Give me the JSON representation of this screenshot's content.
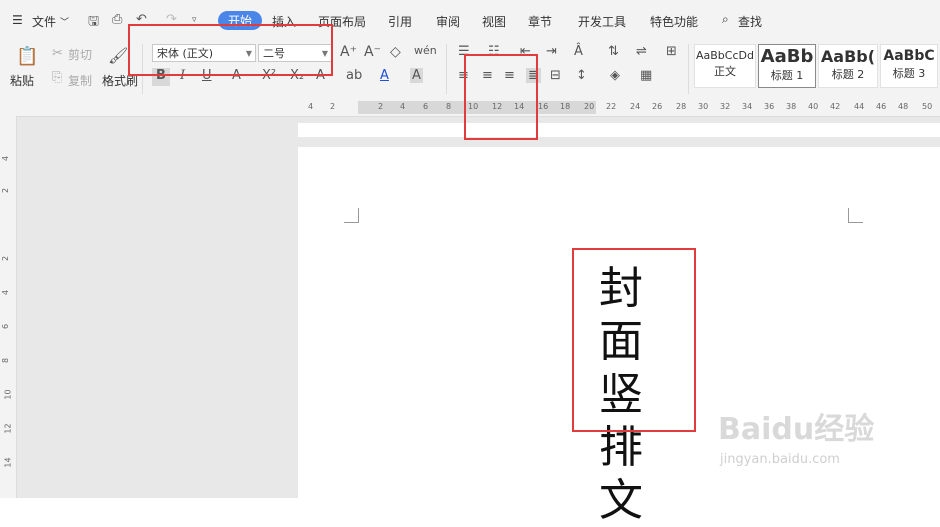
{
  "menubar": {
    "file": "文件",
    "tabs": [
      "开始",
      "插入",
      "页面布局",
      "引用",
      "审阅",
      "视图",
      "章节",
      "开发工具",
      "特色功能"
    ],
    "search": "查找"
  },
  "ribbon": {
    "paste": "粘贴",
    "cut": "剪切",
    "copy": "复制",
    "format_painter": "格式刷",
    "font_name": "宋体 (正文)",
    "font_size": "二号",
    "styles": [
      {
        "preview": "AaBbCcDd",
        "label": "正文"
      },
      {
        "preview": "AaBb",
        "label": "标题 1"
      },
      {
        "preview": "AaBb(",
        "label": "标题 2"
      },
      {
        "preview": "AaBbC",
        "label": "标题 3"
      }
    ]
  },
  "ruler_top": [
    "4",
    "2",
    "2",
    "4",
    "6",
    "8",
    "10",
    "12",
    "14",
    "16",
    "18",
    "20",
    "22",
    "24",
    "26",
    "28",
    "30",
    "32",
    "34",
    "36",
    "38",
    "40",
    "42",
    "44",
    "46",
    "48",
    "50"
  ],
  "ruler_left": [
    "4",
    "2",
    "2",
    "4",
    "6",
    "8",
    "10",
    "12",
    "14"
  ],
  "document": {
    "vertical_text": [
      "封",
      "面",
      "竖",
      "排",
      "文"
    ]
  },
  "watermark": {
    "brand": "Baidu经验",
    "url": "jingyan.baidu.com"
  },
  "colors": {
    "accent": "#4a86e8",
    "highlight": "#e03c3c"
  }
}
